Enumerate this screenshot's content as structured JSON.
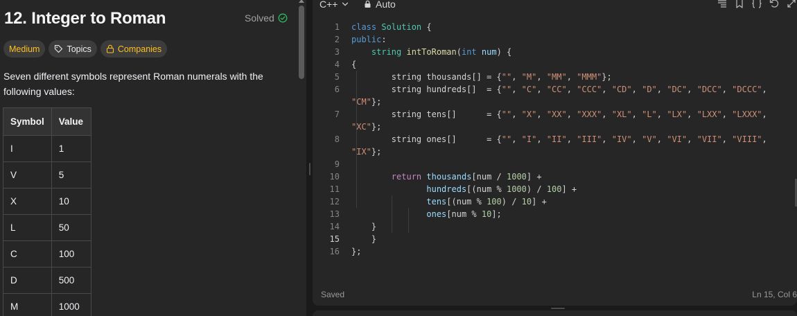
{
  "problem": {
    "title": "12. Integer to Roman",
    "solved_label": "Solved",
    "tags": {
      "difficulty": "Medium",
      "topics": "Topics",
      "companies": "Companies"
    },
    "description": "Seven different symbols represent Roman numerals with the following values:",
    "table": {
      "headers": [
        "Symbol",
        "Value"
      ],
      "rows": [
        [
          "I",
          "1"
        ],
        [
          "V",
          "5"
        ],
        [
          "X",
          "10"
        ],
        [
          "L",
          "50"
        ],
        [
          "C",
          "100"
        ],
        [
          "D",
          "500"
        ],
        [
          "M",
          "1000"
        ]
      ]
    }
  },
  "editor": {
    "language": "C++",
    "mode": "Auto",
    "line_numbers": [
      "1",
      "2",
      "3",
      "4",
      "5",
      "6",
      "",
      "7",
      "",
      "8",
      "",
      "9",
      "10",
      "11",
      "12",
      "13",
      "14",
      "15",
      "16"
    ],
    "current_line": "15",
    "status_left": "Saved",
    "status_right": "Ln 15, Col 6"
  },
  "colors": {
    "accent": "#ffc01e",
    "solved": "#2cbb5d",
    "keyword": "#569cd6",
    "type": "#4ec9b0",
    "function": "#dcdcaa",
    "variable": "#9cdcfe",
    "string": "#ce9178",
    "number": "#b5cea8"
  }
}
